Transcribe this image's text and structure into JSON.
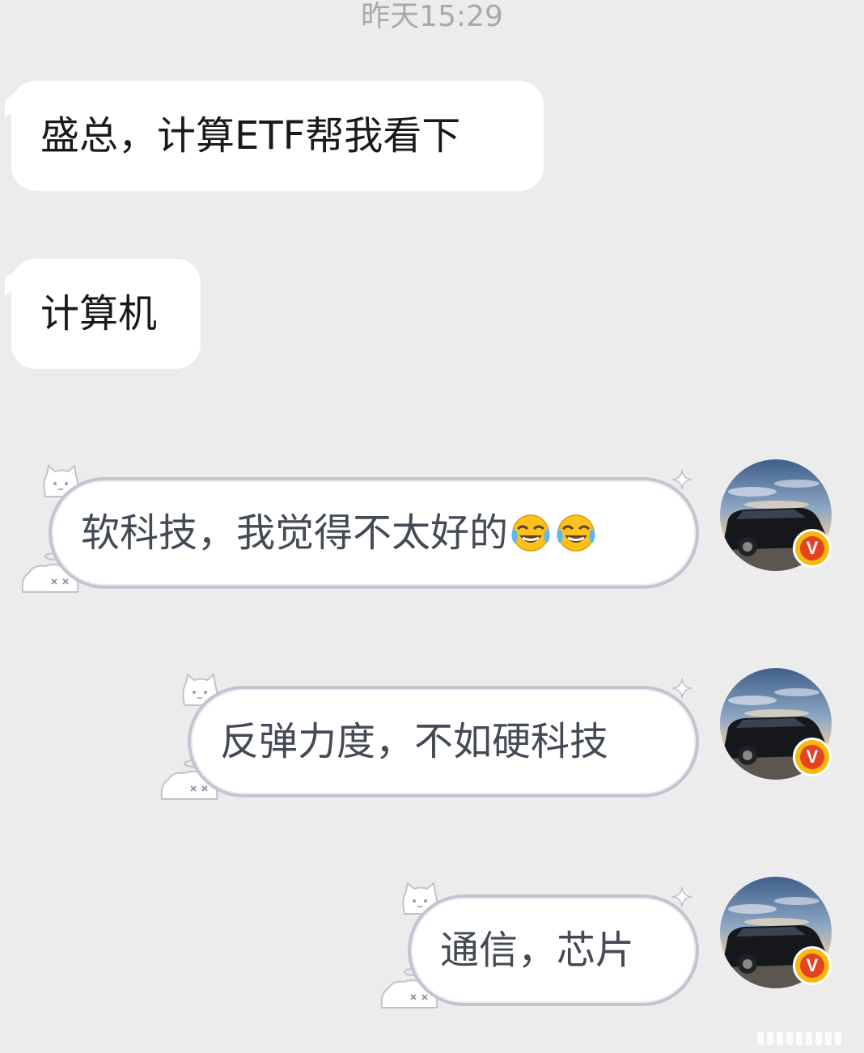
{
  "timestamp": "昨天15:29",
  "incoming_messages": [
    {
      "text": "盛总，计算ETF帮我看下"
    },
    {
      "text": "计算机"
    }
  ],
  "outgoing_messages": [
    {
      "text": "软科技，我觉得不太好的",
      "emoji": [
        "face-with-tears-of-joy-icon",
        "face-with-tears-of-joy-icon"
      ]
    },
    {
      "text": "反弹力度，不如硬科技"
    },
    {
      "text": "通信，芯片"
    }
  ],
  "avatar": {
    "badge_text": "V",
    "badge_color": "#f7b90e",
    "badge_inner_color": "#e6421f"
  },
  "colors": {
    "background": "#ececec",
    "incoming_bubble": "#ffffff",
    "outgoing_border": "#c2c5cf",
    "outgoing_text": "#444a55",
    "timestamp": "#a9a9a9"
  }
}
